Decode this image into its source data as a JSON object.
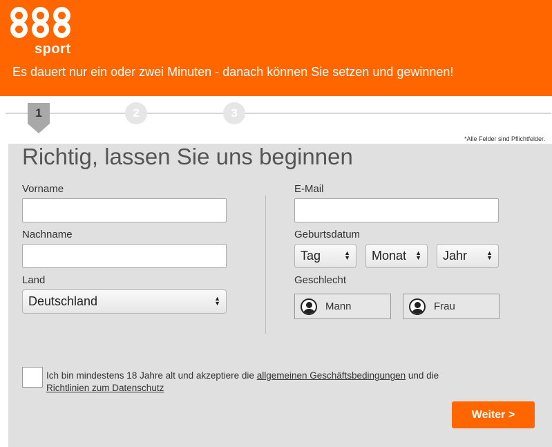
{
  "brand": {
    "logo_digits": [
      "8",
      "8",
      "8"
    ],
    "logo_sub": "sport",
    "tagline": "Es dauert nur ein oder zwei Minuten - danach können Sie setzen und gewinnen!",
    "accent_color": "#ff6600"
  },
  "steps": {
    "items": [
      "1",
      "2",
      "3"
    ],
    "active": "1",
    "required_note": "*Alle Felder sind Pflichtfelder."
  },
  "form": {
    "title": "Richtig, lassen Sie uns beginnen",
    "first_name": {
      "label": "Vorname",
      "value": ""
    },
    "last_name": {
      "label": "Nachname",
      "value": ""
    },
    "country": {
      "label": "Land",
      "value": "Deutschland"
    },
    "email": {
      "label": "E-Mail",
      "value": ""
    },
    "birthdate": {
      "label": "Geburtsdatum",
      "day": "Tag",
      "month": "Monat",
      "year": "Jahr"
    },
    "gender": {
      "label": "Geschlecht",
      "male": "Mann",
      "female": "Frau"
    },
    "terms": {
      "text_before": "Ich bin mindestens 18 Jahre alt und akzeptiere die ",
      "link_terms": "allgemeinen Geschäftsbedingungen",
      "text_middle": " und die ",
      "link_privacy": "Richtlinien zum Datenschutz"
    },
    "submit_label": "Weiter >"
  }
}
